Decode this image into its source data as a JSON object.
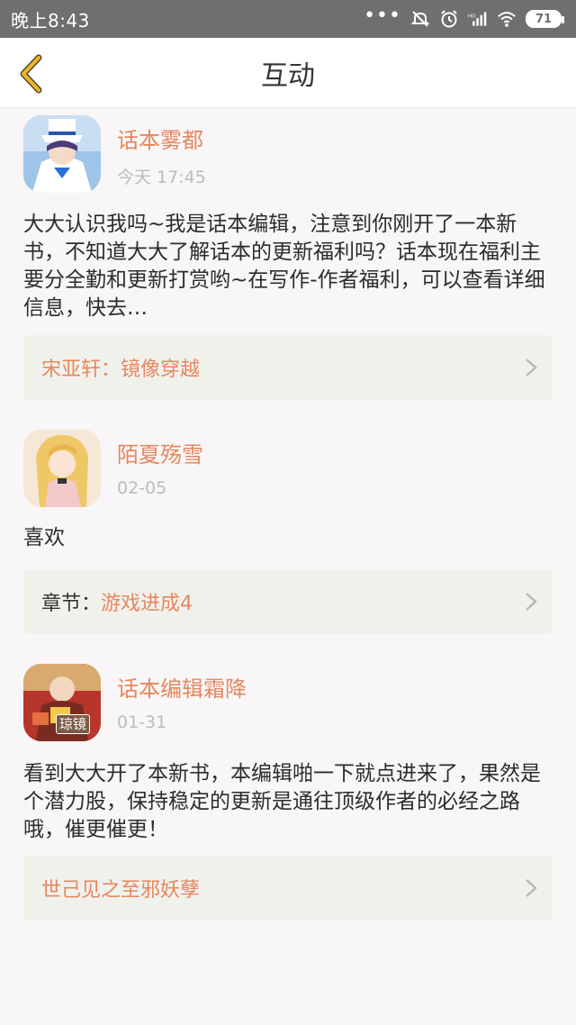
{
  "status_bar": {
    "time": "晚上8:43",
    "battery": "71",
    "icons": [
      "more-dots-icon",
      "mute-icon",
      "alarm-icon",
      "hd-signal-icon",
      "wifi-icon",
      "battery-icon"
    ]
  },
  "header": {
    "title": "互动",
    "back_icon": "chevron-left-icon",
    "accent_color": "#f0b429"
  },
  "items": [
    {
      "name": "话本雾都",
      "date": "今天 17:45",
      "message": "大大认识我吗~我是话本编辑，注意到你刚开了一本新书，不知道大大了解话本的更新福利吗？话本现在福利主要分全勤和更新打赏哟~在写作-作者福利，可以查看详细信息，快去…",
      "ref_prefix": "",
      "ref_text": "宋亚轩：镜像穿越"
    },
    {
      "name": "陌夏殇雪",
      "date": "02-05",
      "message": "喜欢",
      "ref_prefix": "章节：",
      "ref_text": "游戏进成4"
    },
    {
      "name": "话本编辑霜降",
      "date": "01-31",
      "message": "看到大大开了本新书，本编辑啪一下就点进来了，果然是个潜力股，保持稳定的更新是通往顶级作者的必经之路哦，催更催更！",
      "ref_prefix": "",
      "ref_text": "世己见之至邪妖孽",
      "avatar_badge": "琼镜"
    }
  ],
  "colors": {
    "name": "#e5875f",
    "date": "#bcbcbc",
    "ref_bg": "#f1f1ec",
    "page_bg": "#f8f6f6"
  }
}
